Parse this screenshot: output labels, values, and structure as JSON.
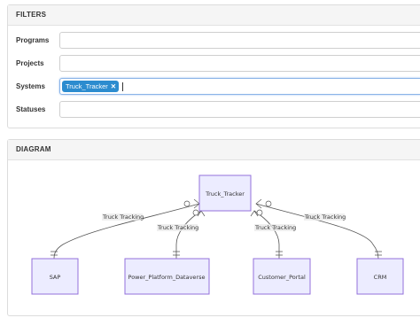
{
  "filters": {
    "title": "FILTERS",
    "programs_label": "Programs",
    "projects_label": "Projects",
    "systems_label": "Systems",
    "statuses_label": "Statuses",
    "systems_tags": [
      {
        "label": "Truck_Tracker",
        "remove": "✕"
      }
    ]
  },
  "diagram": {
    "title": "DIAGRAM",
    "center": "Truck_Tracker",
    "nodes": [
      "SAP",
      "Power_Platform_Dataverse",
      "Customer_Portal",
      "CRM"
    ],
    "edge_label": "Truck Tracking"
  }
}
